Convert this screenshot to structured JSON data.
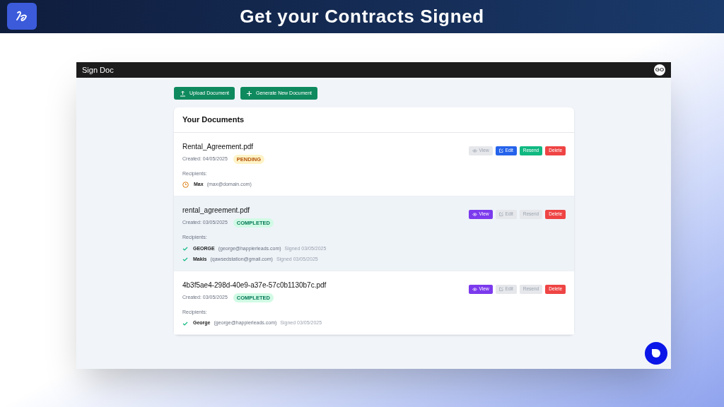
{
  "banner": {
    "title": "Get your Contracts Signed"
  },
  "window": {
    "title": "Sign Doc",
    "avatar": "GO"
  },
  "toolbar": [
    {
      "label": "Upload Document",
      "kind": "upload"
    },
    {
      "label": "Generate New Document",
      "kind": "generate"
    }
  ],
  "documents_panel": {
    "title": "Your Documents",
    "documents": [
      {
        "name": "Rental_Agreement.pdf",
        "created": "Created: 04/05/2025",
        "status": "PENDING",
        "kind": "pending",
        "highlighted": false,
        "recipients_label": "Recipients:",
        "recipients": [
          {
            "name": "Max",
            "email": "(max@domain.com)",
            "signed": false
          }
        ],
        "actions": [
          {
            "label": "View",
            "kind": "view",
            "disabled": true
          },
          {
            "label": "Edit",
            "kind": "edit",
            "disabled": false
          },
          {
            "label": "Resend",
            "kind": "resend",
            "disabled": false
          },
          {
            "label": "Delete",
            "kind": "delete",
            "disabled": false
          }
        ]
      },
      {
        "name": "rental_agreement.pdf",
        "created": "Created: 03/05/2025",
        "status": "COMPLETED",
        "kind": "completed",
        "highlighted": true,
        "recipients_label": "Recipients:",
        "recipients": [
          {
            "name": "GEORGE",
            "email": "(george@happierleads.com)",
            "signed": true,
            "signed_text": "Signed 03/05/2025"
          },
          {
            "name": "Makis",
            "email": "(qawsedstation@gmail.com)",
            "signed": true,
            "signed_text": "Signed 03/05/2025"
          }
        ],
        "actions": [
          {
            "label": "View",
            "kind": "view",
            "disabled": false
          },
          {
            "label": "Edit",
            "kind": "edit",
            "disabled": true
          },
          {
            "label": "Resend",
            "kind": "resend",
            "disabled": true
          },
          {
            "label": "Delete",
            "kind": "delete",
            "disabled": false
          }
        ]
      },
      {
        "name": "4b3f5ae4-298d-40e9-a37e-57c0b1130b7c.pdf",
        "created": "Created: 03/05/2025",
        "status": "COMPLETED",
        "kind": "completed",
        "highlighted": false,
        "recipients_label": "Recipients:",
        "recipients": [
          {
            "name": "George",
            "email": "(george@happierleads.com)",
            "signed": true,
            "signed_text": "Signed 03/05/2025"
          }
        ],
        "actions": [
          {
            "label": "View",
            "kind": "view",
            "disabled": false
          },
          {
            "label": "Edit",
            "kind": "edit",
            "disabled": true
          },
          {
            "label": "Resend",
            "kind": "resend",
            "disabled": true
          },
          {
            "label": "Delete",
            "kind": "delete",
            "disabled": false
          }
        ]
      }
    ]
  }
}
